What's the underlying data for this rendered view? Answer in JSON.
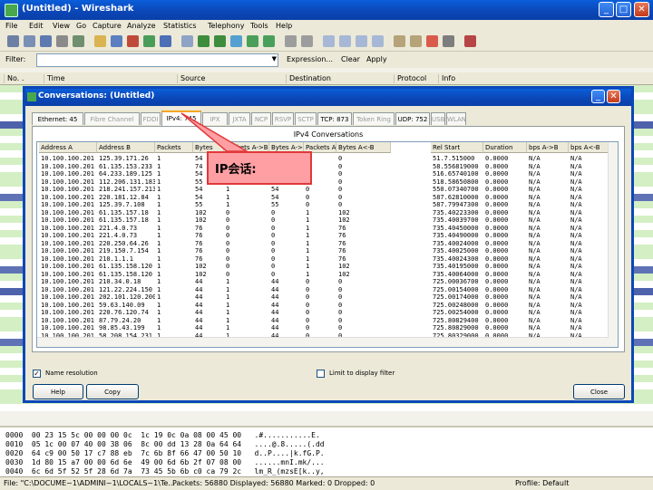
{
  "window": {
    "title": "(Untitled) - Wireshark",
    "buttons": {
      "minimize": "_",
      "maximize": "□",
      "close": "✕"
    }
  },
  "menu": [
    "File",
    "Edit",
    "View",
    "Go",
    "Capture",
    "Analyze",
    "Statistics",
    "Telephony",
    "Tools",
    "Help"
  ],
  "filter": {
    "label": "Filter:",
    "value": "",
    "expression": "Expression...",
    "clear": "Clear",
    "apply": "Apply"
  },
  "packet_list": {
    "columns": [
      "No. .",
      "Time",
      "Source",
      "Destination",
      "Protocol",
      "Info"
    ]
  },
  "dialog": {
    "title": "Conversations: (Untitled)",
    "tabs": [
      {
        "label": "Ethernet: 45",
        "state": "normal"
      },
      {
        "label": "Fibre Channel",
        "state": "disabled"
      },
      {
        "label": "FDDI",
        "state": "disabled"
      },
      {
        "label": "IPv4: 745",
        "state": "active"
      },
      {
        "label": "IPX",
        "state": "disabled"
      },
      {
        "label": "JXTA",
        "state": "disabled"
      },
      {
        "label": "NCP",
        "state": "disabled"
      },
      {
        "label": "RSVP",
        "state": "disabled"
      },
      {
        "label": "SCTP",
        "state": "disabled"
      },
      {
        "label": "TCP: 873",
        "state": "normal"
      },
      {
        "label": "Token Ring",
        "state": "disabled"
      },
      {
        "label": "UDP: 752",
        "state": "normal"
      },
      {
        "label": "USB",
        "state": "disabled"
      },
      {
        "label": "WLAN",
        "state": "disabled"
      }
    ],
    "panel_title": "IPv4 Conversations",
    "columns": [
      "Address A",
      "Address B",
      "Packets",
      "Bytes",
      "Packets A->B",
      "Bytes A->B",
      "Packets A<-B",
      "Bytes A<-B",
      "Rel Start",
      "Duration",
      "bps A->B",
      "bps A<-B"
    ],
    "rows": [
      [
        "10.100.100.201",
        "125.39.171.26",
        "1",
        "54",
        "1",
        "54",
        "0",
        "0",
        "51.7.515000",
        "0.0000",
        "N/A",
        "N/A"
      ],
      [
        "10.100.100.201",
        "61.135.153.233",
        "1",
        "74",
        "1",
        "74",
        "0",
        "0",
        "58.556819000",
        "0.0000",
        "N/A",
        "N/A"
      ],
      [
        "10.100.100.201",
        "64.233.189.125",
        "1",
        "54",
        "1",
        "54",
        "0",
        "0",
        "516.65740100",
        "0.0000",
        "N/A",
        "N/A"
      ],
      [
        "10.100.100.201",
        "112.206.131.183",
        "1",
        "55",
        "1",
        "55",
        "0",
        "0",
        "518.58650800",
        "0.0000",
        "N/A",
        "N/A"
      ],
      [
        "10.100.100.201",
        "218.241.157.213",
        "1",
        "54",
        "1",
        "54",
        "0",
        "0",
        "550.07340700",
        "0.0000",
        "N/A",
        "N/A"
      ],
      [
        "10.100.100.201",
        "220.181.12.84",
        "1",
        "54",
        "1",
        "54",
        "0",
        "0",
        "587.62810000",
        "0.0000",
        "N/A",
        "N/A"
      ],
      [
        "10.100.100.201",
        "125.39.7.108",
        "1",
        "55",
        "1",
        "55",
        "0",
        "0",
        "587.79947300",
        "0.0000",
        "N/A",
        "N/A"
      ],
      [
        "10.100.100.201",
        "61.135.157.18",
        "1",
        "102",
        "0",
        "0",
        "1",
        "102",
        "735.40223300",
        "0.0000",
        "N/A",
        "N/A"
      ],
      [
        "10.100.100.201",
        "61.135.157.18",
        "1",
        "102",
        "0",
        "0",
        "1",
        "102",
        "735.40039700",
        "0.0000",
        "N/A",
        "N/A"
      ],
      [
        "10.100.100.201",
        "221.4.0.73",
        "1",
        "76",
        "0",
        "0",
        "1",
        "76",
        "735.40450000",
        "0.0000",
        "N/A",
        "N/A"
      ],
      [
        "10.100.100.201",
        "221.4.0.73",
        "1",
        "76",
        "0",
        "0",
        "1",
        "76",
        "735.40490000",
        "0.0000",
        "N/A",
        "N/A"
      ],
      [
        "10.100.100.201",
        "220.250.64.26",
        "1",
        "76",
        "0",
        "0",
        "1",
        "76",
        "735.40024000",
        "0.0000",
        "N/A",
        "N/A"
      ],
      [
        "10.100.100.201",
        "219.150.7.154",
        "1",
        "76",
        "0",
        "0",
        "1",
        "76",
        "735.40025000",
        "0.0000",
        "N/A",
        "N/A"
      ],
      [
        "10.100.100.201",
        "210.1.1.1",
        "1",
        "76",
        "0",
        "0",
        "1",
        "76",
        "735.40024300",
        "0.0000",
        "N/A",
        "N/A"
      ],
      [
        "10.100.100.201",
        "61.135.158.120",
        "1",
        "102",
        "0",
        "0",
        "1",
        "102",
        "735.40195000",
        "0.0000",
        "N/A",
        "N/A"
      ],
      [
        "10.100.100.201",
        "61.135.158.120",
        "1",
        "102",
        "0",
        "0",
        "1",
        "102",
        "735.40064000",
        "0.0000",
        "N/A",
        "N/A"
      ],
      [
        "10.100.100.201",
        "210.34.0.18",
        "1",
        "44",
        "1",
        "44",
        "0",
        "0",
        "725.00036700",
        "0.0000",
        "N/A",
        "N/A"
      ],
      [
        "10.100.100.201",
        "121.22.224.150",
        "1",
        "44",
        "1",
        "44",
        "0",
        "0",
        "725.00154000",
        "0.0000",
        "N/A",
        "N/A"
      ],
      [
        "10.100.100.201",
        "202.101.120.200",
        "1",
        "44",
        "1",
        "44",
        "0",
        "0",
        "725.00174000",
        "0.0000",
        "N/A",
        "N/A"
      ],
      [
        "10.100.100.201",
        "59.63.140.09",
        "1",
        "44",
        "1",
        "44",
        "0",
        "0",
        "725.00248000",
        "0.0000",
        "N/A",
        "N/A"
      ],
      [
        "10.100.100.201",
        "220.76.120.74",
        "1",
        "44",
        "1",
        "44",
        "0",
        "0",
        "725.00254000",
        "0.0000",
        "N/A",
        "N/A"
      ],
      [
        "10.100.100.201",
        "87.79.24.20",
        "1",
        "44",
        "1",
        "44",
        "0",
        "0",
        "725.80829400",
        "0.0000",
        "N/A",
        "N/A"
      ],
      [
        "10.100.100.201",
        "98.85.43.199",
        "1",
        "44",
        "1",
        "44",
        "0",
        "0",
        "725.80829000",
        "0.0000",
        "N/A",
        "N/A"
      ],
      [
        "10.100.100.201",
        "58.208.154.231",
        "1",
        "44",
        "1",
        "44",
        "0",
        "0",
        "725.80329000",
        "0.0000",
        "N/A",
        "N/A"
      ]
    ],
    "name_resolution": {
      "label": "Name resolution",
      "checked": true
    },
    "limit_filter": {
      "label": "Limit to display filter",
      "checked": false
    },
    "buttons": {
      "help": "Help",
      "copy": "Copy",
      "close": "Close"
    }
  },
  "callout": {
    "text": "IP会话:"
  },
  "bytes": [
    "0000  00 23 15 5c 00 00 00 0c  1c 19 0c 0a 08 00 45 00   .#...........E.",
    "0010  05 1c 00 07 40 00 38 06  8c 00 dd 13 28 0a 64 64   ....@.8.....(.dd",
    "0020  64 c9 00 50 17 c7 88 eb  7c 6b 8f 66 47 00 50 10   d..P....|k.fG.P.",
    "0030  1d 80 15 a7 00 00 6d 6e  49 00 6d 6b 2f 07 08 00   ......mnI.mk/...",
    "0040  6c 6d 5f 52 5f 28 6d 7a  73 45 5b 6b c0 ca 79 2c   lm_R_(mzsE[k..y,"
  ],
  "status": {
    "file": "File: \"C:\\DOCUME~1\\ADMINI~1\\LOCALS~1\\Te...",
    "packets": "Packets: 56880 Displayed: 56880 Marked: 0 Dropped: 0",
    "profile": "Profile: Default"
  },
  "colors": {
    "xp_blue": "#0b47b8",
    "callout_fill": "#ff9fa3",
    "callout_border": "#e0393a",
    "row_green": "#d4efc4"
  }
}
